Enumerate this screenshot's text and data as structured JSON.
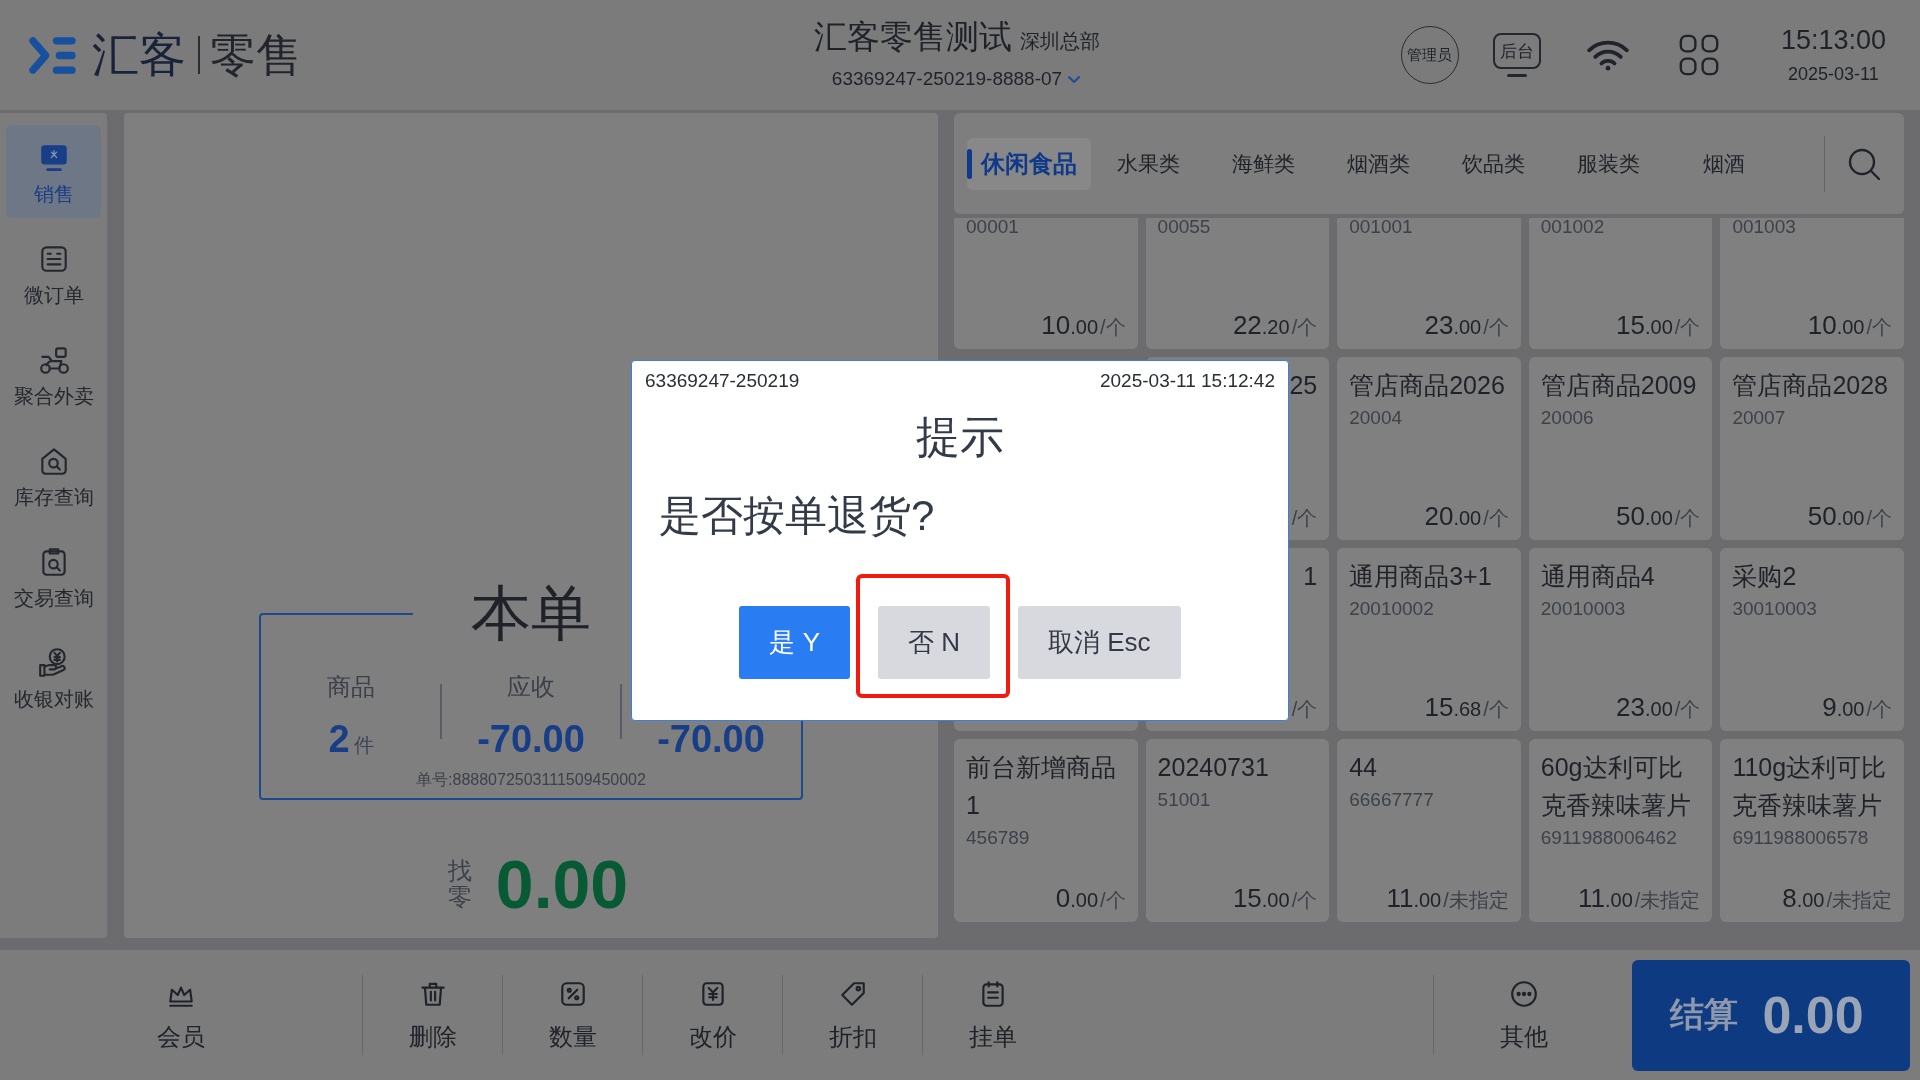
{
  "header": {
    "brand": "汇客",
    "app_name": "零售",
    "store_name": "汇客零售测试",
    "branch": "深圳总部",
    "terminal": "63369247-250219-8888-07",
    "role": "管理员",
    "backend": "后台",
    "time": "15:13:00",
    "date": "2025-03-11"
  },
  "sidebar": {
    "items": [
      {
        "label": "销售",
        "selected": true
      },
      {
        "label": "微订单",
        "selected": false
      },
      {
        "label": "聚合外卖",
        "selected": false
      },
      {
        "label": "库存查询",
        "selected": false
      },
      {
        "label": "交易查询",
        "selected": false
      },
      {
        "label": "收银对账",
        "selected": false
      }
    ]
  },
  "order_summary": {
    "title": "本单",
    "stats": [
      {
        "label": "商品",
        "value": "2",
        "unit": "件"
      },
      {
        "label": "应收",
        "value": "-70.00"
      },
      {
        "value": "-70.00"
      }
    ],
    "order_number": "单号:8888072503111509450002",
    "change_label": "找零",
    "change_value": "0.00"
  },
  "categories": {
    "tabs": [
      {
        "label": "休闲食品",
        "selected": true
      },
      {
        "label": "水果类",
        "selected": false
      },
      {
        "label": "海鲜类",
        "selected": false
      },
      {
        "label": "烟酒类",
        "selected": false
      },
      {
        "label": "饮品类",
        "selected": false
      },
      {
        "label": "服装类",
        "selected": false
      },
      {
        "label": "烟酒",
        "selected": false
      }
    ]
  },
  "products": [
    {
      "kind": "card",
      "code": "00001",
      "price": "10.00",
      "unit": "/个"
    },
    {
      "kind": "card",
      "code": "00055",
      "price": "22.20",
      "unit": "/个"
    },
    {
      "kind": "card",
      "code": "001001",
      "price": "23.00",
      "unit": "/个"
    },
    {
      "kind": "card",
      "code": "001002",
      "price": "15.00",
      "unit": "/个"
    },
    {
      "kind": "card",
      "code": "001003",
      "price": "10.00",
      "unit": "/个"
    },
    {
      "kind": "hidden"
    },
    {
      "kind": "covered",
      "name": "25",
      "unit": "/个"
    },
    {
      "kind": "card",
      "name": "管店商品2026",
      "code": "20004",
      "price": "20.00",
      "unit": "/个"
    },
    {
      "kind": "card",
      "name": "管店商品2009",
      "code": "20006",
      "price": "50.00",
      "unit": "/个"
    },
    {
      "kind": "card",
      "name": "管店商品2028",
      "code": "20007",
      "price": "50.00",
      "unit": "/个"
    },
    {
      "kind": "covered"
    },
    {
      "kind": "covered",
      "name": "1",
      "unit": "/个"
    },
    {
      "kind": "card",
      "name": "通用商品3+1",
      "code": "20010002",
      "price": "15.68",
      "unit": "/个"
    },
    {
      "kind": "card",
      "name": "通用商品4",
      "code": "20010003",
      "price": "23.00",
      "unit": "/个"
    },
    {
      "kind": "card",
      "name": "采购2",
      "code": "30010003",
      "price": "9.00",
      "unit": "/个"
    },
    {
      "kind": "card",
      "name": "前台新增商品1",
      "code": "456789",
      "price": "0.00",
      "unit": "/个"
    },
    {
      "kind": "card",
      "name": "20240731",
      "code": "51001",
      "price": "15.00",
      "unit": "/个"
    },
    {
      "kind": "card",
      "name": "44",
      "code": "66667777",
      "price": "11.00",
      "unit": "/未指定"
    },
    {
      "kind": "card",
      "name": "60g达利可比克香辣味薯片",
      "code": "6911988006462",
      "price": "11.00",
      "unit": "/未指定"
    },
    {
      "kind": "card",
      "name": "110g达利可比克香辣味薯片",
      "code": "6911988006578",
      "price": "8.00",
      "unit": "/未指定"
    }
  ],
  "toolbar": {
    "actions": [
      "会员",
      "删除",
      "数量",
      "改价",
      "折扣",
      "挂单"
    ],
    "more": "其他",
    "checkout": {
      "label": "结算",
      "amount": "0.00"
    }
  },
  "dialog": {
    "terminal": "63369247-250219",
    "timestamp": "2025-03-11 15:12:42",
    "title": "提示",
    "message": "是否按单退货?",
    "buttons": [
      {
        "label": "是 Y",
        "kind": "primary",
        "highlighted": false
      },
      {
        "label": "否 N",
        "kind": "secondary",
        "highlighted": true
      },
      {
        "label": "取消 Esc",
        "kind": "secondary",
        "highlighted": false
      }
    ]
  }
}
